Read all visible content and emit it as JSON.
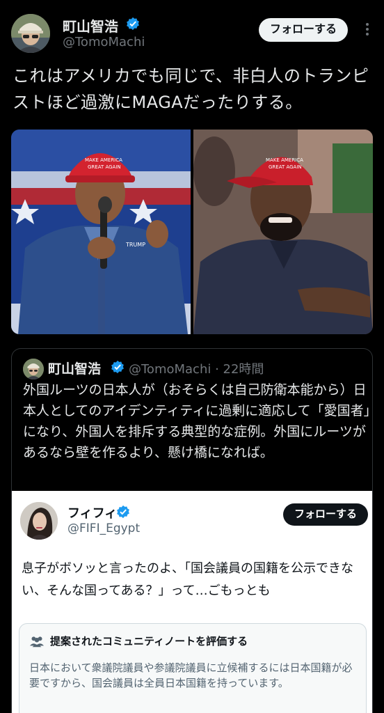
{
  "post": {
    "name": "町山智浩",
    "handle": "@TomoMachi",
    "follow_label": "フォローする",
    "text": "これはアメリカでも同じで、非白人のトランピストほど過激にMAGAだったりする。"
  },
  "quote": {
    "name": "町山智浩",
    "meta": "@TomoMachi · 22時間",
    "text": "外国ルーツの日本人が（おそらくは自己防衛本能から）日本人としてのアイデンティティに過剰に適応して「愛国者」になり、外国人を排斥する典型的な症例。外国にルーツがあるなら壁を作るより、懸け橋になれば。"
  },
  "embedded": {
    "name": "フィフィ",
    "handle": "@FIFI_Egypt",
    "follow_label": "フォローする",
    "text": "息子がボソッと言ったのよ、「国会議員の国籍を公示できない、そんな国ってある？」って…ごもっとも",
    "note": {
      "title": "提案されたコミュニティノートを評価する",
      "body": "日本において衆議院議員や参議院議員に立候補するには日本国籍が必要ですから、国会議員は全員日本国籍を持っています。"
    }
  },
  "icons": {
    "verified": "verified-badge-icon",
    "more": "more-dots-icon",
    "note": "people-icon"
  },
  "colors": {
    "background": "#000000",
    "verified": "#1d9bf0",
    "muted": "#71767b"
  }
}
